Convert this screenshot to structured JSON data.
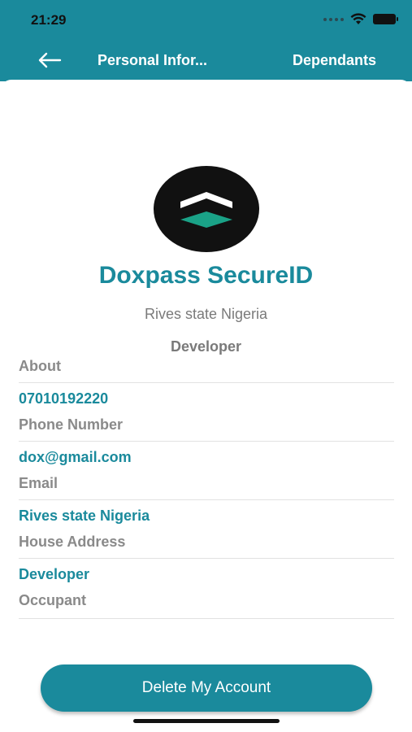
{
  "status_bar": {
    "time": "21:29"
  },
  "nav": {
    "title": "Personal Infor...",
    "action": "Dependants"
  },
  "profile": {
    "name": "Doxpass SecureID",
    "location": "Rives state Nigeria",
    "role": "Developer"
  },
  "fields": [
    {
      "value": "",
      "label": "About"
    },
    {
      "value": "07010192220",
      "label": "Phone Number"
    },
    {
      "value": "dox@gmail.com",
      "label": "Email"
    },
    {
      "value": "Rives state Nigeria",
      "label": "House Address"
    },
    {
      "value": "Developer",
      "label": "Occupant"
    }
  ],
  "delete_button": {
    "label": "Delete My Account"
  },
  "colors": {
    "primary": "#1a8a9c",
    "logo_bg": "#111111",
    "logo_accent": "#1aa287"
  },
  "icons": {
    "back": "arrow-left-icon",
    "wifi": "wifi-icon",
    "battery": "battery-icon",
    "signal": "signal-dots-icon"
  }
}
